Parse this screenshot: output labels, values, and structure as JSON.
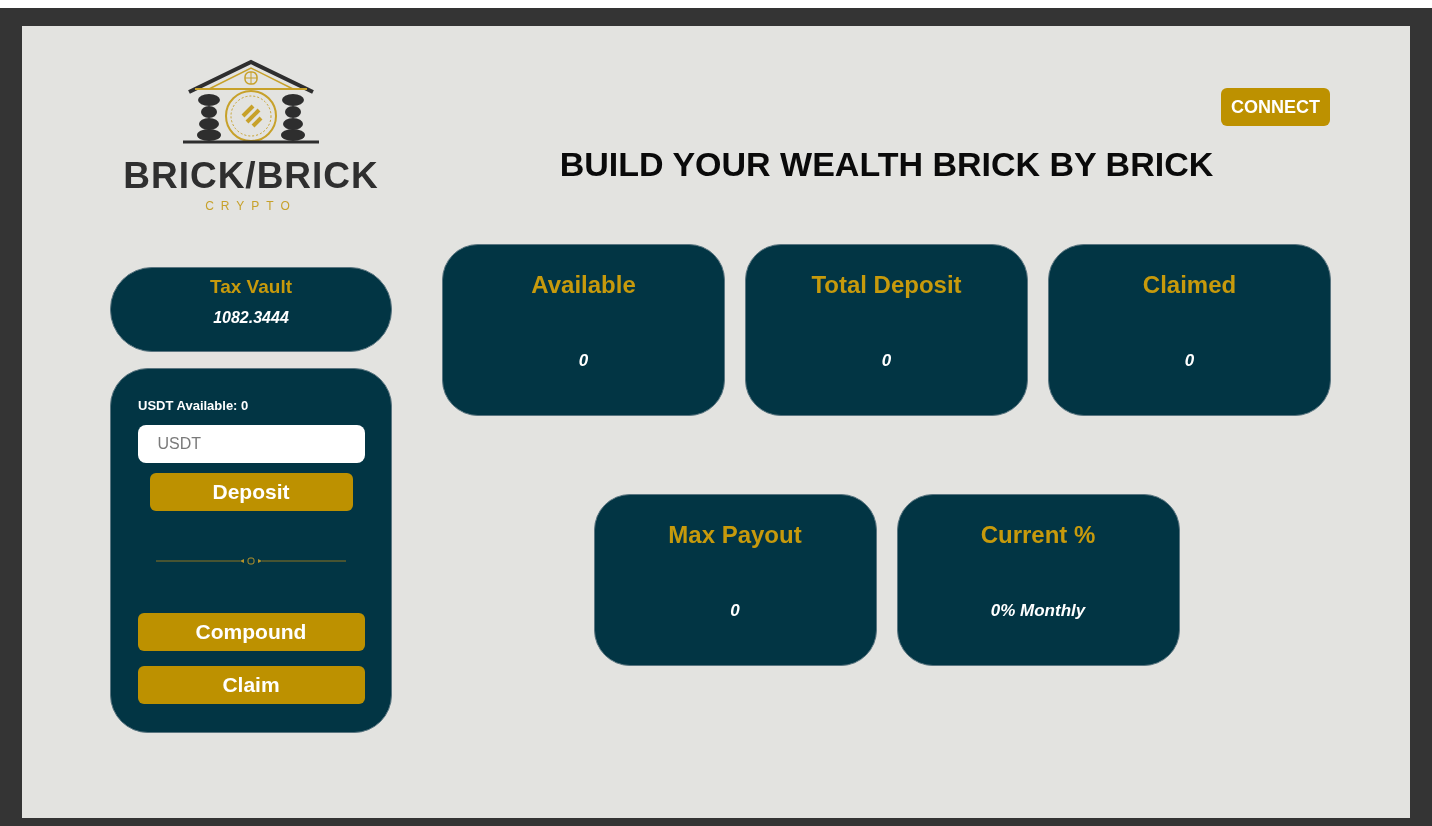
{
  "logo": {
    "name": "BRICK/BRICK",
    "tagline": "CRYPTO"
  },
  "connect_button": "CONNECT",
  "headline": "BUILD YOUR WEALTH BRICK BY BRICK",
  "tax_vault": {
    "label": "Tax Vault",
    "value": "1082.3444"
  },
  "deposit_panel": {
    "balance": "USDT Available: 0",
    "amount_field": {
      "placeholder": "USDT"
    },
    "deposit_button": "Deposit",
    "compound_button": "Compound",
    "claim_button": "Claim"
  },
  "stats": [
    {
      "label": "Available",
      "value": "0"
    },
    {
      "label": "Total Deposit",
      "value": "0"
    },
    {
      "label": "Claimed",
      "value": "0"
    },
    {
      "label": "Max Payout",
      "value": "0"
    },
    {
      "label": "Current %",
      "value": "0% Monthly"
    }
  ]
}
